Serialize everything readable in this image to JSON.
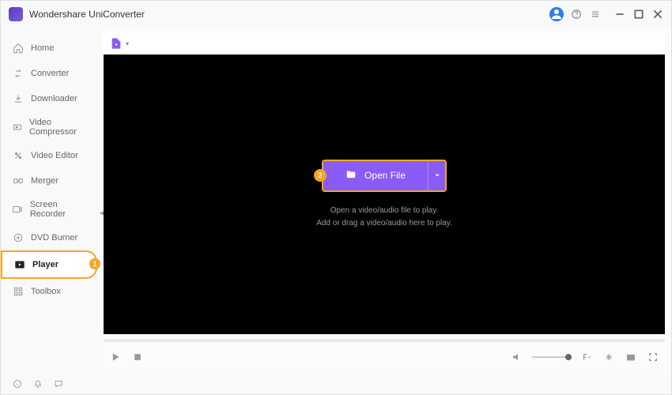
{
  "app": {
    "title": "Wondershare UniConverter"
  },
  "sidebar": {
    "items": [
      {
        "label": "Home",
        "icon": "home-icon"
      },
      {
        "label": "Converter",
        "icon": "converter-icon"
      },
      {
        "label": "Downloader",
        "icon": "downloader-icon"
      },
      {
        "label": "Video Compressor",
        "icon": "compressor-icon"
      },
      {
        "label": "Video Editor",
        "icon": "editor-icon"
      },
      {
        "label": "Merger",
        "icon": "merger-icon"
      },
      {
        "label": "Screen Recorder",
        "icon": "recorder-icon"
      },
      {
        "label": "DVD Burner",
        "icon": "dvd-icon"
      },
      {
        "label": "Player",
        "icon": "player-icon",
        "active": true,
        "badge": "1"
      },
      {
        "label": "Toolbox",
        "icon": "toolbox-icon"
      }
    ]
  },
  "main": {
    "open_button": "Open File",
    "hint_line1": "Open a video/audio file to play.",
    "hint_line2": "Add or drag a video/audio here to play.",
    "annotation_badge": "2"
  },
  "colors": {
    "accent": "#8a5cf6",
    "highlight": "#f5a623"
  }
}
